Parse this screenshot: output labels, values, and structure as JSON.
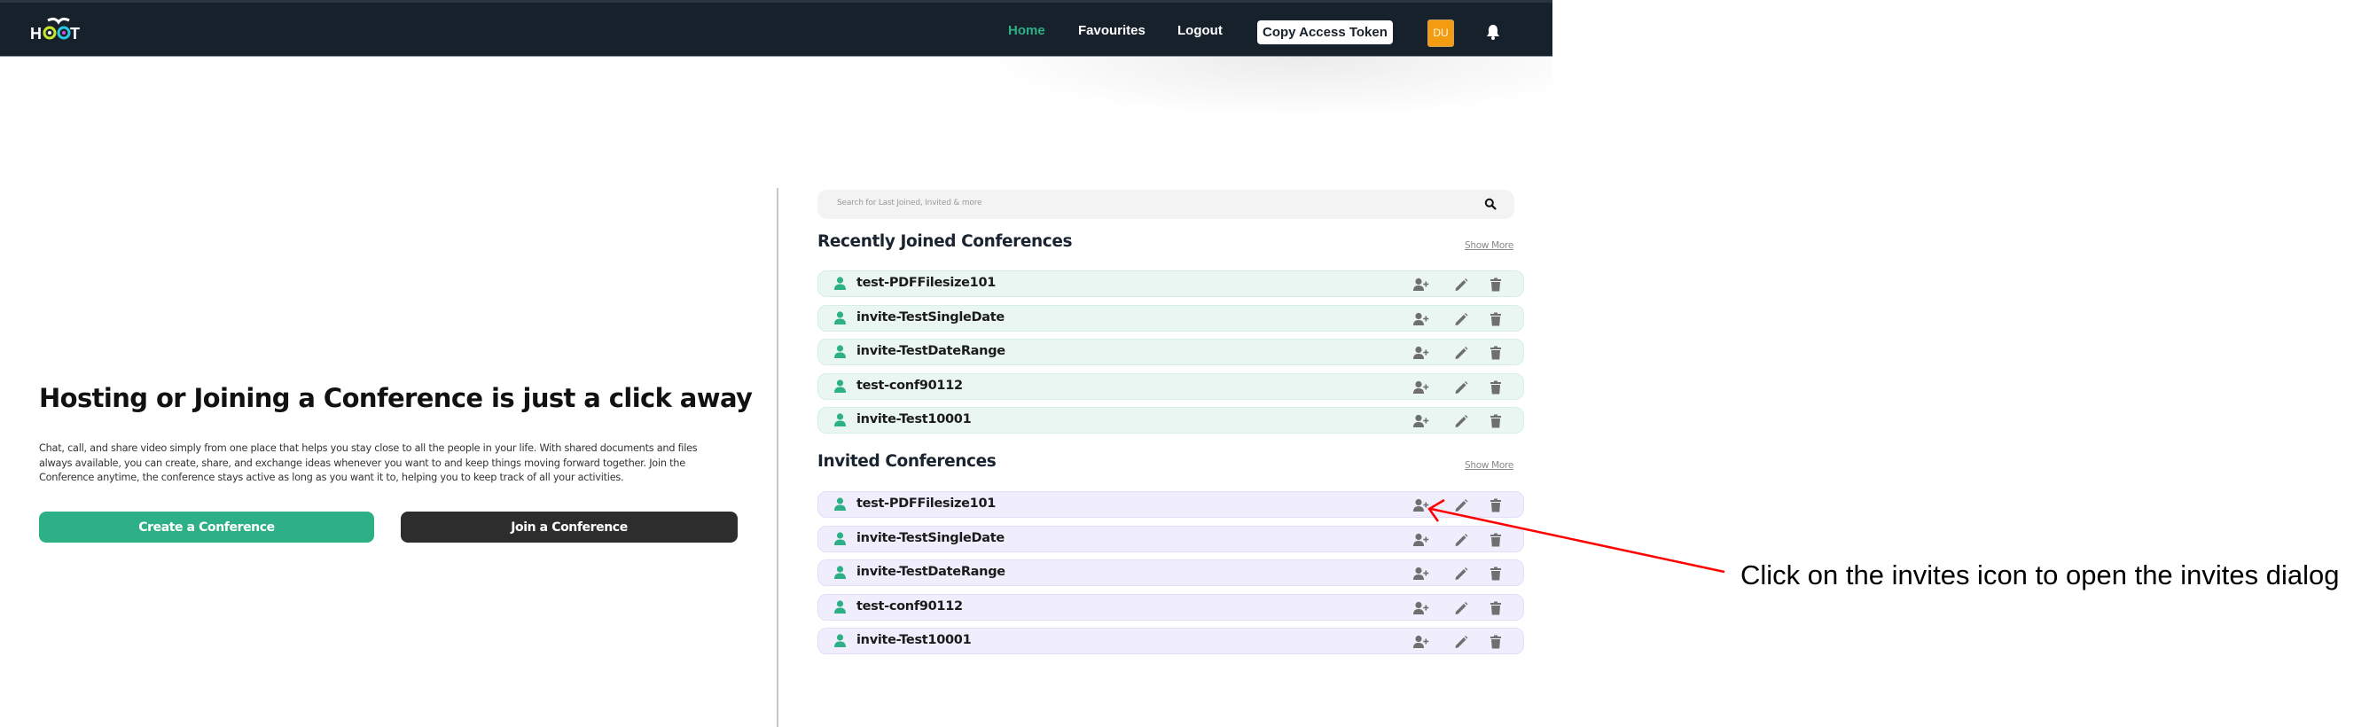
{
  "navbar": {
    "logo_alt": "HOOT",
    "links": [
      {
        "label": "Home",
        "active": true
      },
      {
        "label": "Favourites",
        "active": false
      },
      {
        "label": "Logout",
        "active": false
      }
    ],
    "token_button": "Copy Access Token",
    "avatar_initials": "DU",
    "icons": {
      "notifications": "bell-icon"
    },
    "colors": {
      "background": "#17212b",
      "active_link": "#2eb086",
      "avatar": "#f39c12"
    }
  },
  "hero": {
    "title": "Hosting or Joining a Conference is just a click away",
    "description": "Chat, call, and share video simply from one place that helps you stay close to all the people in your life. With shared documents and files always available, you can create, share, and exchange ideas whenever you want to and keep things moving forward together. Join the Conference anytime, the conference stays active as long as you want it to, helping you to keep track of all your activities.",
    "create_button": "Create a Conference",
    "join_button": "Join a Conference",
    "colors": {
      "create": "#2eb086",
      "join": "#2d2d2d"
    }
  },
  "search": {
    "placeholder": "Search for Last Joined, Invited & more",
    "icon": "search-icon"
  },
  "recently_joined": {
    "title": "Recently Joined Conferences",
    "show_more": "Show More",
    "items": [
      {
        "name": "test-PDFFilesize101"
      },
      {
        "name": "invite-TestSingleDate"
      },
      {
        "name": "invite-TestDateRange"
      },
      {
        "name": "test-conf90112"
      },
      {
        "name": "invite-Test10001"
      }
    ]
  },
  "invited": {
    "title": "Invited Conferences",
    "show_more": "Show More",
    "items": [
      {
        "name": "test-PDFFilesize101"
      },
      {
        "name": "invite-TestSingleDate"
      },
      {
        "name": "invite-TestDateRange"
      },
      {
        "name": "test-conf90112"
      },
      {
        "name": "invite-Test10001"
      }
    ]
  },
  "row_actions": [
    "user-plus-icon",
    "pencil-icon",
    "trash-icon"
  ],
  "annotation": {
    "text": "Click on the invites icon to open the invites dialog",
    "arrow_color": "#ff0000"
  }
}
